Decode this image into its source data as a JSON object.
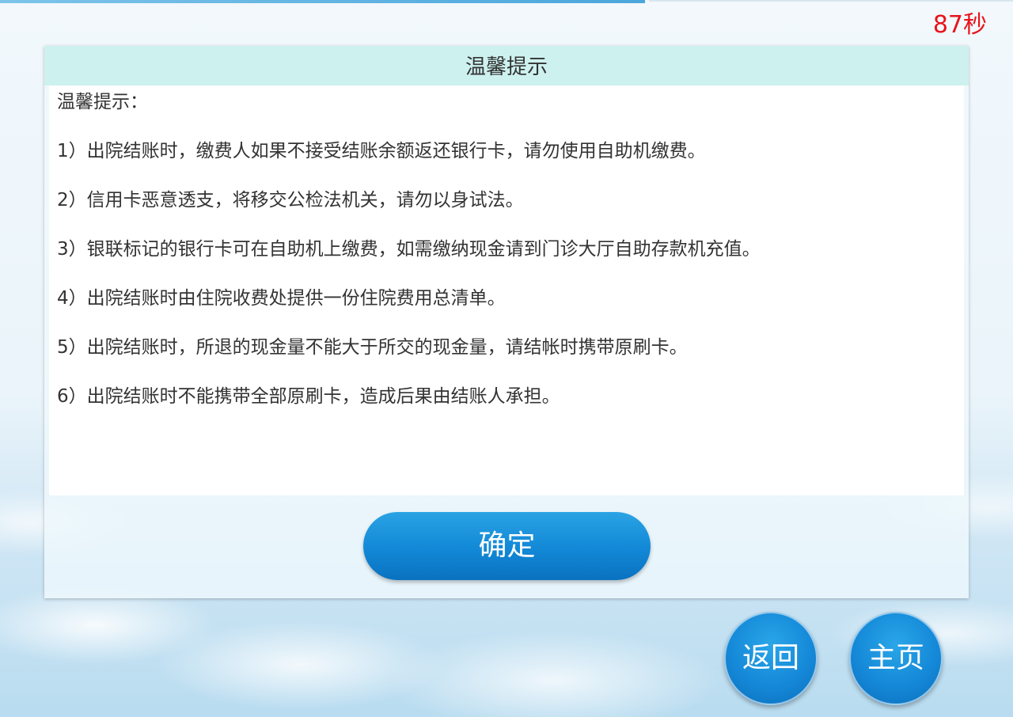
{
  "countdown": "87秒",
  "dialog": {
    "title": "温馨提示",
    "notice_title": "温馨提示：",
    "items": [
      "1）出院结账时，缴费人如果不接受结账余额返还银行卡，请勿使用自助机缴费。",
      "2）信用卡恶意透支，将移交公检法机关，请勿以身试法。",
      "3）银联标记的银行卡可在自助机上缴费，如需缴纳现金请到门诊大厅自助存款机充值。",
      "4）出院结账时由住院收费处提供一份住院费用总清单。",
      "5）出院结账时，所退的现金量不能大于所交的现金量，请结帐时携带原刷卡。",
      "6）出院结账时不能携带全部原刷卡，造成后果由结账人承担。"
    ],
    "confirm_label": "确定"
  },
  "nav": {
    "back_label": "返回",
    "home_label": "主页"
  },
  "colors": {
    "countdown": "#e8141a",
    "header_bg": "#cdf1ef",
    "button_blue": "#1288d6"
  }
}
